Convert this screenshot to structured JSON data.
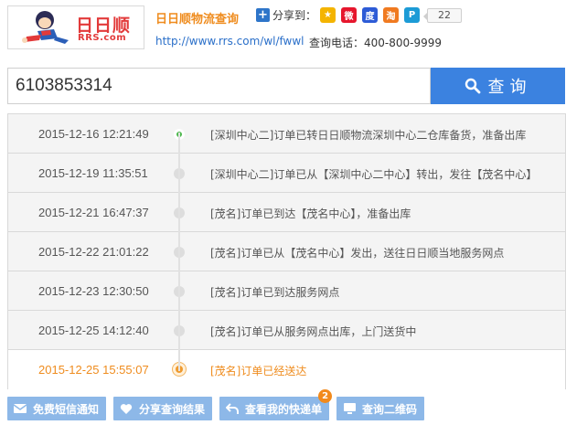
{
  "brand": {
    "logo_cn": "日日顺",
    "logo_en": "RRS.com",
    "site_title": "日日顺物流查询",
    "url": "http://www.rrs.com/wl/fwwl",
    "phone": "查询电话：400-800-9999"
  },
  "share": {
    "label": "分享到：",
    "count": "22",
    "icons": [
      {
        "name": "qzone-icon",
        "color": "#f4b400",
        "glyph": "★"
      },
      {
        "name": "weibo-icon",
        "color": "#e6162d",
        "glyph": "微"
      },
      {
        "name": "baidu-icon",
        "color": "#2d5bd6",
        "glyph": "度"
      },
      {
        "name": "renren-icon",
        "color": "#f07a20",
        "glyph": "淘"
      },
      {
        "name": "tqq-icon",
        "color": "#1c9bd6",
        "glyph": "P"
      }
    ]
  },
  "search": {
    "value": "6103853314",
    "button_label": "查询"
  },
  "timeline": [
    {
      "time": "2015-12-16 12:21:49",
      "text": "[深圳中心二]订单已转日日顺物流深圳中心二仓库备货，准备出库"
    },
    {
      "time": "2015-12-19 11:35:51",
      "text": "[深圳中心二]订单已从【深圳中心二中心】转出，发往【茂名中心】"
    },
    {
      "time": "2015-12-21 16:47:37",
      "text": "[茂名]订单已到达【茂名中心】，准备出库"
    },
    {
      "time": "2015-12-22 21:01:22",
      "text": "[茂名]订单已从【茂名中心】发出，送往日日顺当地服务网点"
    },
    {
      "time": "2015-12-23 12:30:50",
      "text": "[茂名]订单已到达服务网点"
    },
    {
      "time": "2015-12-25 14:12:40",
      "text": "[茂名]订单已从服务网点出库，上门送货中"
    },
    {
      "time": "2015-12-25 15:55:07",
      "text": "[茂名]订单已经送达"
    }
  ],
  "actions": {
    "sms": "免费短信通知",
    "share": "分享查询结果",
    "my_orders": "查看我的快递单",
    "my_orders_badge": "2",
    "qrcode": "查询二维码"
  }
}
